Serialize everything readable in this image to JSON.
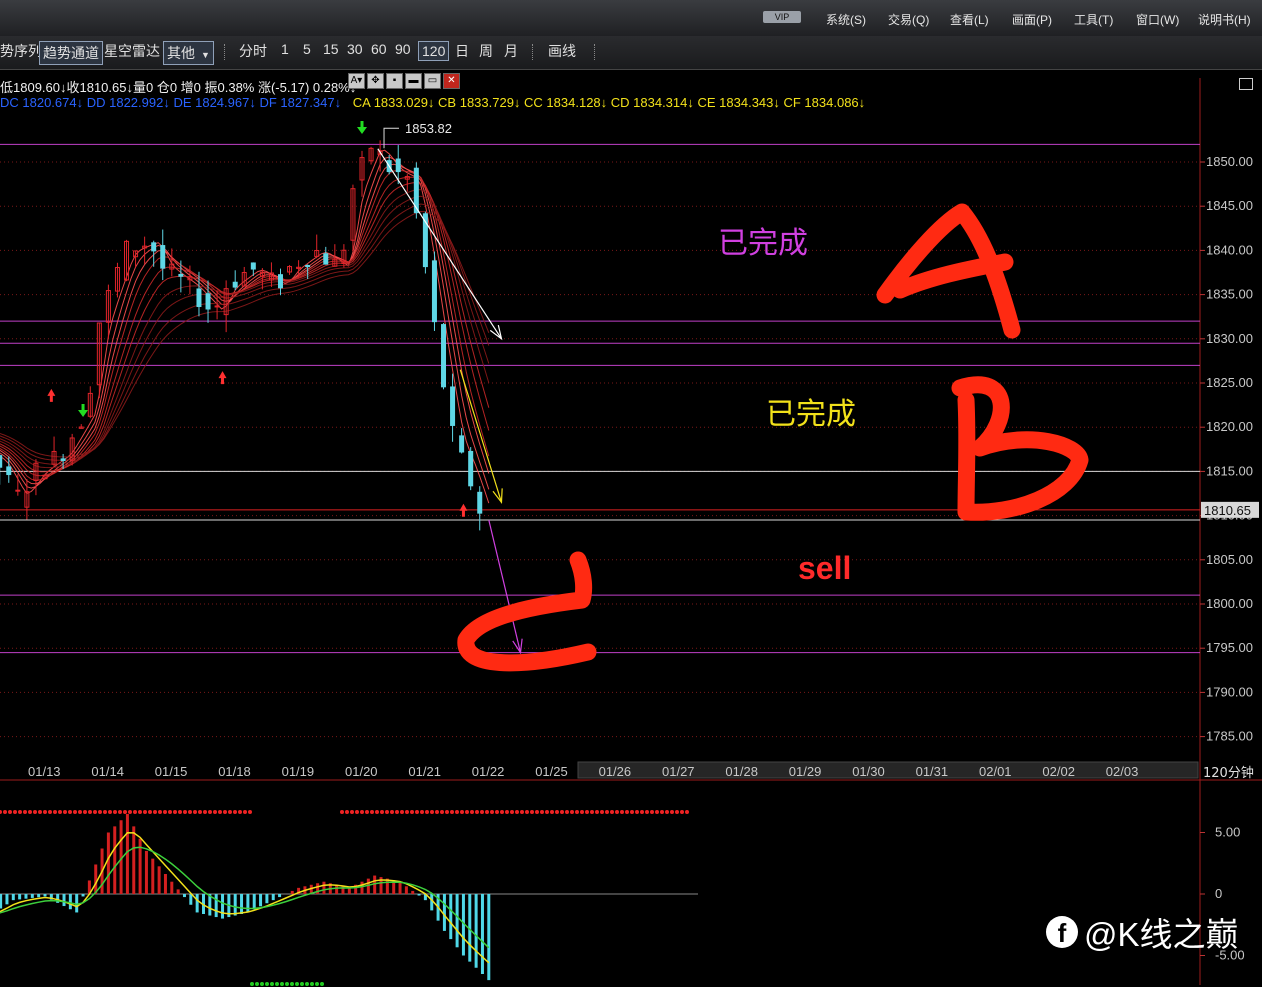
{
  "menu": {
    "vip": "VIP",
    "items": [
      "系统(S)",
      "交易(Q)",
      "查看(L)",
      "画面(P)",
      "工具(T)",
      "窗口(W)",
      "说明书(H)"
    ]
  },
  "toolbar": {
    "items": [
      "势序列",
      "趋势通道",
      "星空雷达",
      "其他",
      "分时",
      "1",
      "5",
      "15",
      "30",
      "60",
      "90",
      "120",
      "日",
      "周",
      "月",
      "画线"
    ],
    "selected_period": "120"
  },
  "info_line1": "低1809.60↓收1810.65↓量0  仓0  增0 振0.38%  涨(-5.17) 0.28%↓",
  "info_line2_blue": "DC 1820.674↓  DD 1822.992↓  DE 1824.967↓  DF 1827.347↓",
  "info_line2_yellow": "CA 1833.029↓  CB 1833.729↓  CC 1834.128↓  CD 1834.314↓  CE 1834.343↓  CF 1834.086↓",
  "annotations": {
    "high_label": "1853.82",
    "done1": "已完成",
    "done2": "已完成",
    "sell": "sell",
    "letter_a": "A",
    "letter_b": "B",
    "letter_c": "C"
  },
  "watermark": {
    "icon": "facebook-icon",
    "text": "@K线之巅"
  },
  "colors": {
    "up": "#e0242a",
    "down": "#5fd7e6",
    "level_line": "#c040c8",
    "red_marker": "#ff3030",
    "done1": "#d040e0",
    "done2": "#f2e11a",
    "sell": "#ff2a2a",
    "hand_red": "#ff2a12"
  },
  "chart_data": [
    {
      "type": "line",
      "name_label": "120分钟",
      "period_label": "120分钟",
      "x_dates": [
        "01/13",
        "01/14",
        "01/15",
        "01/18",
        "01/19",
        "01/20",
        "01/21",
        "01/22",
        "01/25",
        "01/26",
        "01/27",
        "01/28",
        "01/29",
        "01/30",
        "01/31",
        "02/01",
        "02/02",
        "02/03"
      ],
      "y_ticks": [
        1850,
        1845,
        1840,
        1835,
        1830,
        1825,
        1820,
        1815,
        1810,
        1805,
        1800,
        1795,
        1790,
        1785
      ],
      "ylim": [
        1782.5,
        1855
      ],
      "current_price": 1810.65,
      "last_close_label": "1810.65",
      "level_lines": [
        1852,
        1832,
        1829.5,
        1827,
        1801,
        1794.5
      ],
      "white_lines": [
        1815,
        1809.5
      ],
      "price_path": [
        [
          -4,
          1822
        ],
        [
          -3.6,
          1826
        ],
        [
          -3.3,
          1821
        ],
        [
          -3,
          1823
        ],
        [
          -2.6,
          1820
        ],
        [
          -2.3,
          1824
        ],
        [
          -2,
          1819
        ],
        [
          -1.6,
          1817
        ],
        [
          -1.3,
          1820
        ],
        [
          -1,
          1818
        ],
        [
          -0.6,
          1816
        ],
        [
          -0.3,
          1812
        ],
        [
          0,
          1815
        ],
        [
          0.4,
          1817
        ],
        [
          0.8,
          1822
        ],
        [
          1,
          1832
        ],
        [
          1.4,
          1840
        ],
        [
          1.8,
          1841
        ],
        [
          2,
          1838
        ],
        [
          2.4,
          1836
        ],
        [
          2.8,
          1833
        ],
        [
          3,
          1836
        ],
        [
          3.4,
          1838
        ],
        [
          3.8,
          1836
        ],
        [
          4,
          1838
        ],
        [
          4.4,
          1840
        ],
        [
          4.8,
          1838
        ],
        [
          5,
          1847
        ],
        [
          5.3,
          1852
        ],
        [
          5.6,
          1849
        ],
        [
          5.9,
          1848
        ],
        [
          6.1,
          1840
        ],
        [
          6.4,
          1826
        ],
        [
          6.6,
          1818
        ],
        [
          6.8,
          1815
        ],
        [
          7,
          1810.65
        ]
      ],
      "arrow_targets": [
        {
          "from": [
            5.25,
            1851.5
          ],
          "to": [
            7.2,
            1830
          ]
        },
        {
          "from": [
            6.55,
            1826.5
          ],
          "to": [
            7.2,
            1811.5
          ]
        },
        {
          "from": [
            7,
            1809.5
          ],
          "to": [
            7.5,
            1794.5
          ]
        }
      ],
      "up_markers": [
        [
          -1.5,
          1807
        ],
        [
          0.1,
          1824
        ],
        [
          2.8,
          1826
        ],
        [
          6.6,
          1811
        ]
      ],
      "down_markers": [
        [
          0.6,
          1821.5
        ],
        [
          5.0,
          1853.5
        ]
      ]
    },
    {
      "type": "bar",
      "y_ticks": [
        5.0,
        0,
        -5.0
      ],
      "ylim": [
        -7.5,
        7.5
      ],
      "hist_path": [
        [
          -4,
          0.4
        ],
        [
          -3.5,
          0
        ],
        [
          -3,
          -1
        ],
        [
          -2.5,
          -1.5
        ],
        [
          -2,
          -0.8
        ],
        [
          -1.5,
          -2
        ],
        [
          -1,
          -2.2
        ],
        [
          -0.5,
          -0.5
        ],
        [
          0,
          -0.2
        ],
        [
          0.5,
          -1.5
        ],
        [
          1,
          5
        ],
        [
          1.3,
          6.5
        ],
        [
          1.6,
          3.5
        ],
        [
          2,
          1
        ],
        [
          2.4,
          -1.5
        ],
        [
          2.8,
          -2
        ],
        [
          3.2,
          -1.5
        ],
        [
          3.6,
          -0.5
        ],
        [
          4,
          0.5
        ],
        [
          4.4,
          1
        ],
        [
          4.8,
          0.5
        ],
        [
          5.2,
          1.5
        ],
        [
          5.6,
          1
        ],
        [
          6,
          -0.5
        ],
        [
          6.3,
          -3
        ],
        [
          6.6,
          -5
        ],
        [
          7,
          -7
        ]
      ]
    }
  ]
}
